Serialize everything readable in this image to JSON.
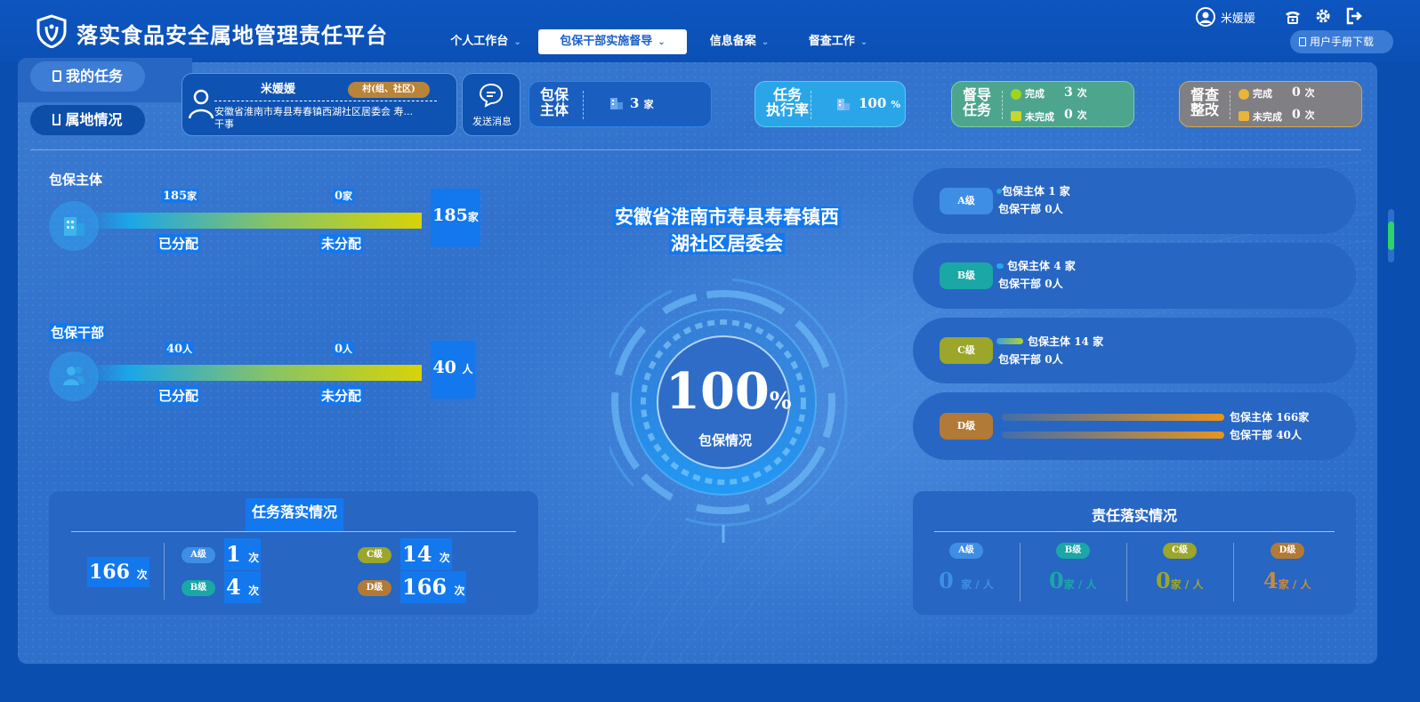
{
  "app": {
    "title": "落实食品安全属地管理责任平台"
  },
  "nav": [
    {
      "label": "个人工作台"
    },
    {
      "label": "包保干部实施督导"
    },
    {
      "label": "信息备案"
    },
    {
      "label": "督查工作"
    }
  ],
  "user": {
    "name": "米媛媛",
    "manual_label": "用户手册下载"
  },
  "side": {
    "my_tasks": "我的任务",
    "territory": "属地情况"
  },
  "profile": {
    "name": "米媛媛",
    "role_tag": "村(组、社区)",
    "org_line1": "安徽省淮南市寿县寿春镇西湖社区居委会  寿...",
    "org_line2": "干事",
    "send_msg": "发送消息"
  },
  "stats": {
    "baobao": {
      "label1": "包保",
      "label2": "主体",
      "value": "3",
      "unit": "家"
    },
    "exec": {
      "label1": "任务",
      "label2": "执行率",
      "value": "100",
      "unit": "%"
    },
    "supervise": {
      "label1": "督导",
      "label2": "任务",
      "done_label": "完成",
      "done_value": "3",
      "undone_label": "未完成",
      "undone_value": "0",
      "unit": "次"
    },
    "inspect": {
      "label1": "督查",
      "label2": "整改",
      "done_label": "完成",
      "done_value": "0",
      "undone_label": "未完成",
      "undone_value": "0",
      "unit": "次"
    }
  },
  "entity": {
    "title": "包保主体",
    "assigned_value": "185",
    "assigned_unit": "家",
    "unassigned_value": "0",
    "unassigned_unit": "家",
    "total_value": "185",
    "total_unit": "家",
    "assigned_label": "已分配",
    "unassigned_label": "未分配",
    "assigned_fraction": 1.0
  },
  "cadre": {
    "title": "包保干部",
    "assigned_value": "40",
    "assigned_unit": "人",
    "unassigned_value": "0",
    "unassigned_unit": "人",
    "total_value": "40",
    "total_unit": "人",
    "assigned_label": "已分配",
    "unassigned_label": "未分配",
    "assigned_fraction": 1.0
  },
  "center": {
    "title_line1": "安徽省淮南市寿县寿春镇西",
    "title_line2": "湖社区居委会",
    "percent": "100",
    "percent_sign": "%",
    "caption": "包保情况"
  },
  "levels": [
    {
      "badge": "A级",
      "color": "#3f8ee6",
      "entity_label": "包保主体",
      "entity_value": "1",
      "entity_unit": "家",
      "cadre_label": "包保干部",
      "cadre_value": "0",
      "cadre_unit": "人",
      "entity_fraction": 0.006,
      "cadre_fraction": 0
    },
    {
      "badge": "B级",
      "color": "#1aa7a6",
      "entity_label": "包保主体",
      "entity_value": "4",
      "entity_unit": "家",
      "cadre_label": "包保干部",
      "cadre_value": "0",
      "cadre_unit": "人",
      "entity_fraction": 0.024,
      "cadre_fraction": 0
    },
    {
      "badge": "C级",
      "color": "#9ba62a",
      "entity_label": "包保主体",
      "entity_value": "14",
      "entity_unit": "家",
      "cadre_label": "包保干部",
      "cadre_value": "0",
      "cadre_unit": "人",
      "entity_fraction": 0.084,
      "cadre_fraction": 0
    },
    {
      "badge": "D级",
      "color": "#b27a36",
      "entity_label": "包保主体",
      "entity_value": "166",
      "entity_unit": "家",
      "cadre_label": "包保干部",
      "cadre_value": "40",
      "cadre_unit": "人",
      "entity_fraction": 1.0,
      "cadre_fraction": 1.0
    }
  ],
  "task_impl": {
    "title": "任务落实情况",
    "total_value": "166",
    "unit": "次",
    "items": [
      {
        "badge": "A级",
        "value": "1",
        "color": "#3f8ee6"
      },
      {
        "badge": "B级",
        "value": "4",
        "color": "#1aa7a6"
      },
      {
        "badge": "C级",
        "value": "14",
        "color": "#9ba62a"
      },
      {
        "badge": "D级",
        "value": "166",
        "color": "#b27a36"
      }
    ]
  },
  "resp_impl": {
    "title": "责任落实情况",
    "unit": "家 / 人",
    "items": [
      {
        "badge": "A级",
        "value": "0",
        "color": "#3f8ee6"
      },
      {
        "badge": "B级",
        "value": "0",
        "color": "#1aa7a6"
      },
      {
        "badge": "C级",
        "value": "0",
        "color": "#9ba62a"
      },
      {
        "badge": "D级",
        "value": "4",
        "color": "#b27a36"
      }
    ]
  },
  "icons": [
    "shield-logo-icon",
    "user-circle-icon",
    "phone-icon",
    "gear-icon",
    "logout-icon",
    "document-icon",
    "map-icon",
    "avatar-icon",
    "chat-icon",
    "building-icon",
    "check-icon",
    "pending-icon",
    "people-icon",
    "chevron-down-icon"
  ]
}
